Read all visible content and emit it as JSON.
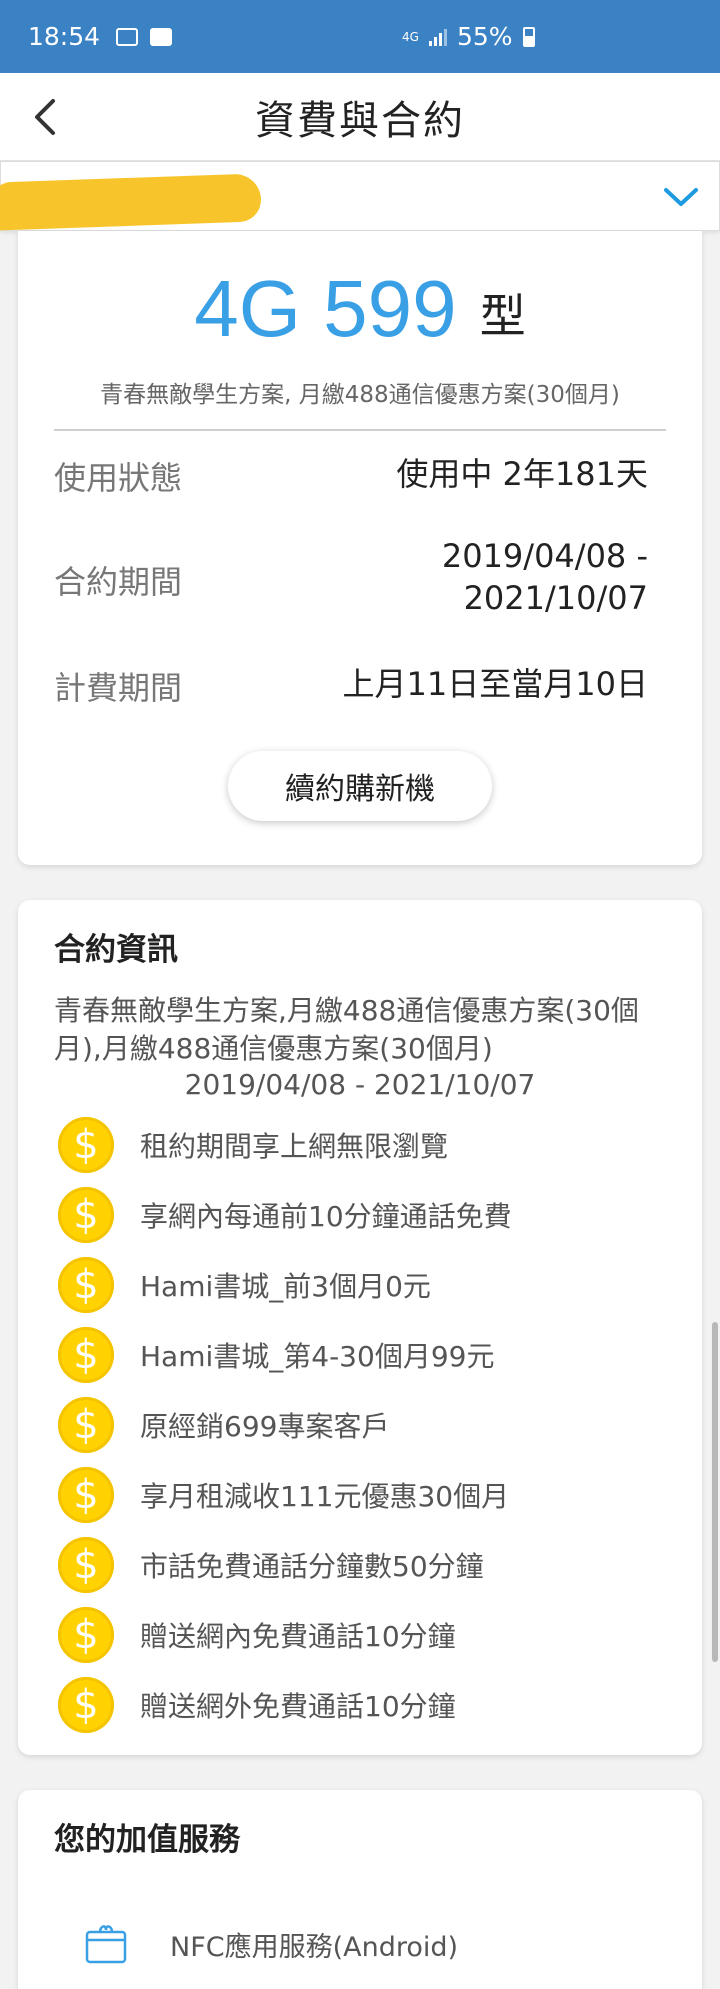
{
  "status_bar": {
    "time": "18:54",
    "network": "4G",
    "battery": "55%",
    "icons": [
      "image-icon",
      "chat-icon",
      "signal-icon",
      "battery-icon"
    ]
  },
  "header": {
    "title": "資費與合約",
    "back_icon": "chevron-left-icon"
  },
  "account_selector": {
    "value": "",
    "icon": "chevron-down-icon"
  },
  "plan_card": {
    "plan_name": "4G 599",
    "plan_suffix": "型",
    "plan_desc": "青春無敵學生方案, 月繳488通信優惠方案(30個月)",
    "rows": [
      {
        "label": "使用狀態",
        "value": "使用中 2年181天"
      },
      {
        "label": "合約期間",
        "value_line1": "2019/04/08 -",
        "value_line2": "2021/10/07"
      },
      {
        "label": "計費期間",
        "value": "上月11日至當月10日"
      }
    ],
    "renew_button": "續約購新機"
  },
  "contract_card": {
    "title": "合約資訊",
    "description": "青春無敵學生方案,月繳488通信優惠方案(30個月),月繳488通信優惠方案(30個月)",
    "date_range": "2019/04/08 - 2021/10/07",
    "benefit_icon": "dollar-coin-icon",
    "benefits": [
      "租約期間享上網無限瀏覽",
      "享網內每通前10分鐘通話免費",
      "Hami書城_前3個月0元",
      "Hami書城_第4-30個月99元",
      "原經銷699專案客戶",
      "享月租減收111元優惠30個月",
      "市話免費通話分鐘數50分鐘",
      "贈送網內免費通話10分鐘",
      "贈送網外免費通話10分鐘"
    ]
  },
  "value_added_card": {
    "title": "您的加值服務",
    "items": [
      {
        "icon": "nfc-card-icon",
        "label": "NFC應用服務(Android)"
      }
    ]
  },
  "colors": {
    "status_bar": "#3b82c4",
    "plan_accent": "#3aa0e6",
    "coin": "#ffd200",
    "chevron": "#1e9be0"
  }
}
